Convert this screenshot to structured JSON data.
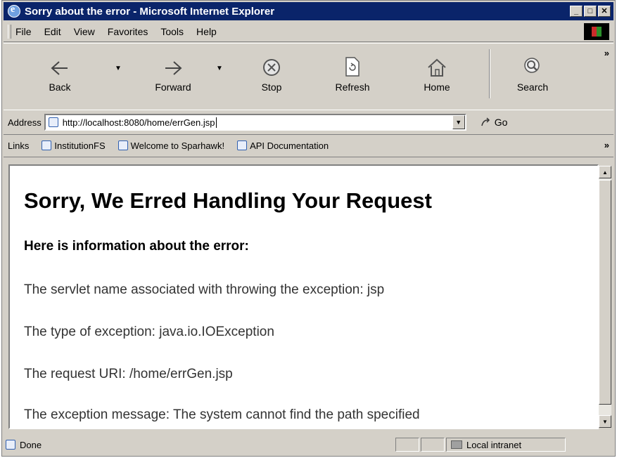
{
  "window": {
    "title": "Sorry about the error - Microsoft Internet Explorer",
    "controls": [
      "_",
      "□",
      "✕"
    ]
  },
  "menu": [
    "File",
    "Edit",
    "View",
    "Favorites",
    "Tools",
    "Help"
  ],
  "toolbar": {
    "back": "Back",
    "forward": "Forward",
    "stop": "Stop",
    "refresh": "Refresh",
    "home": "Home",
    "search": "Search",
    "more": "»"
  },
  "address": {
    "label": "Address",
    "url": "http://localhost:8080/home/errGen.jsp",
    "go": "Go"
  },
  "links": {
    "label": "Links",
    "items": [
      "InstitutionFS",
      "Welcome to Sparhawk!",
      "API Documentation"
    ],
    "more": "»"
  },
  "page": {
    "heading": "Sorry, We Erred Handling Your Request",
    "subheading": "Here is information about the error:",
    "lines": [
      "The servlet name associated with throwing the exception: jsp",
      "The type of exception: java.io.IOException",
      "The request URI: /home/errGen.jsp",
      "The exception message: The system cannot find the path specified"
    ]
  },
  "status": {
    "text": "Done",
    "zone": "Local intranet"
  },
  "colors": {
    "titlebar": "#0a246a",
    "chrome": "#d4d0c8"
  }
}
